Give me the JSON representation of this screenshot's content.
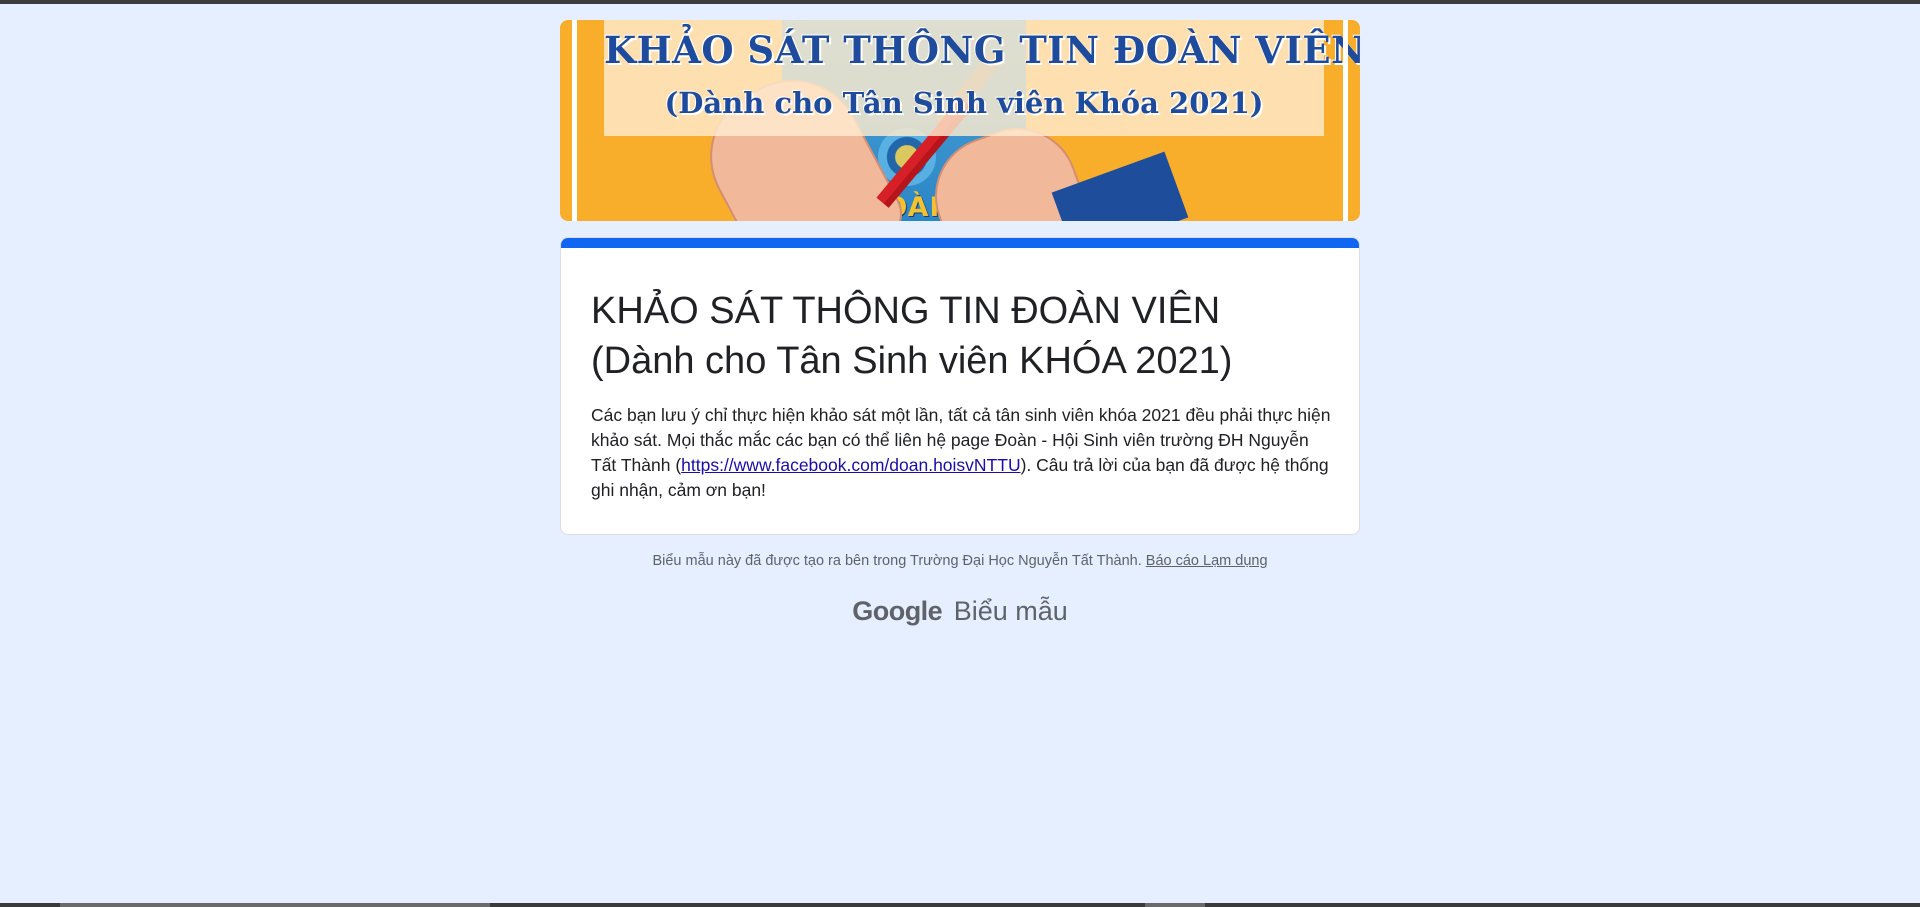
{
  "banner": {
    "title_line1": "KHẢO SÁT THÔNG TIN ĐOÀN VIÊN",
    "title_line2": "(Dành cho Tân Sinh viên Khóa 2021)",
    "book_text": "SỔ ĐOÀN VIÊN",
    "colors": {
      "background": "#f8ae2b",
      "title": "#1e4b9c"
    }
  },
  "form": {
    "title_line1": "KHẢO SÁT THÔNG TIN ĐOÀN VIÊN",
    "title_line2": "(Dành cho Tân Sinh viên KHÓA 2021)",
    "description_before_link": "Các bạn lưu ý chỉ thực hiện khảo sát một lần, tất cả tân sinh viên khóa 2021 đều phải thực hiện khảo sát. Mọi thắc mắc các bạn có thể liên hệ page Đoàn - Hội Sinh viên trường ĐH Nguyễn Tất Thành (",
    "description_link": "https://www.facebook.com/doan.hoisvNTTU",
    "description_after_link": "). Câu trả lời của bạn đã được hệ thống ghi nhận, cảm ơn bạn!",
    "accent_color": "#0f66f0"
  },
  "footer": {
    "note": "Biểu mẫu này đã được tạo ra bên trong Trường Đại Học Nguyễn Tất Thành.",
    "report_link": "Báo cáo Lạm dụng",
    "brand_google": "Google",
    "brand_product": "Biểu mẫu"
  },
  "page": {
    "background": "#e5efff"
  }
}
